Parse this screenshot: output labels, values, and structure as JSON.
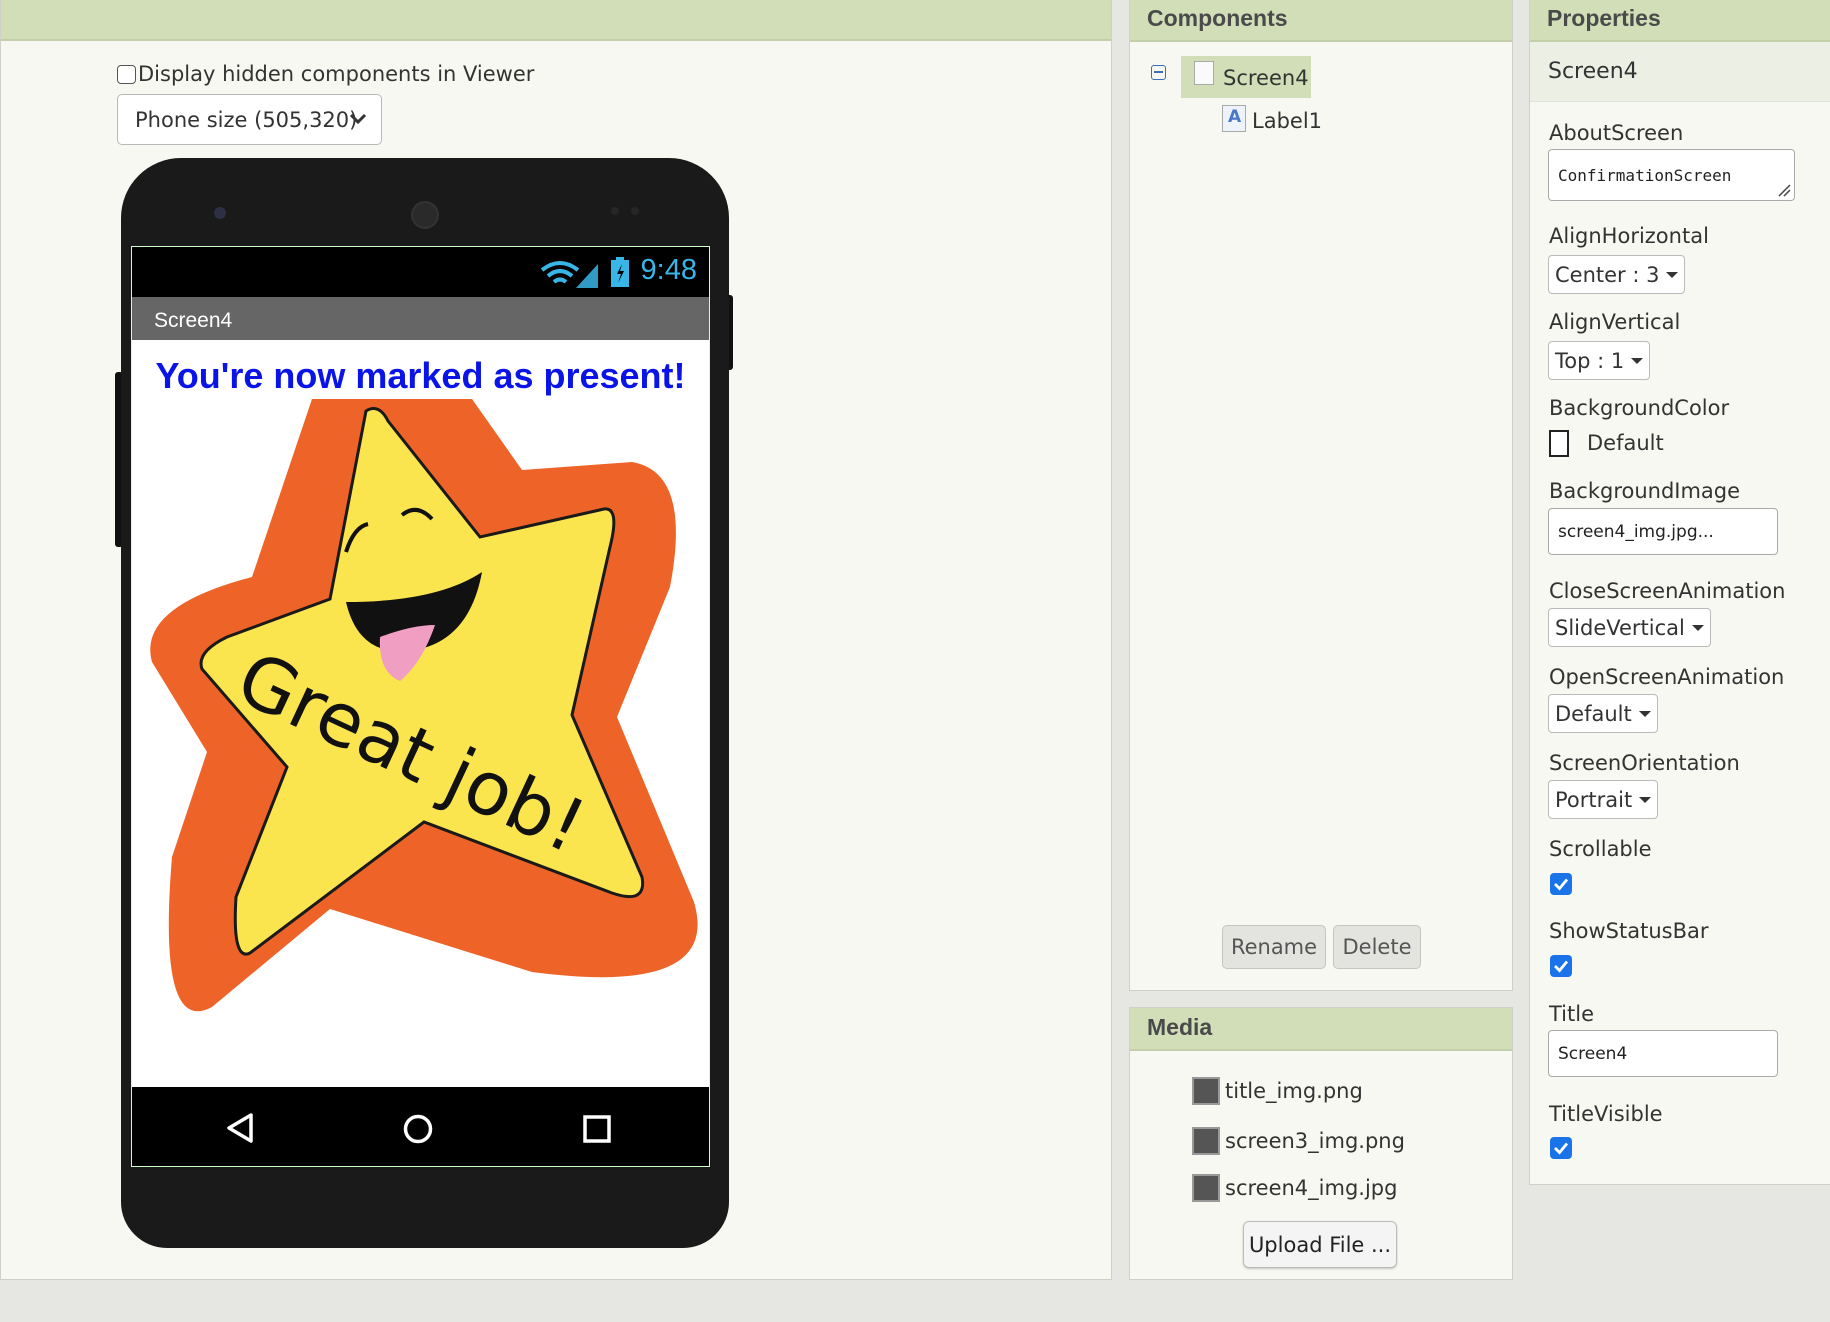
{
  "viewer": {
    "hidden_components_label": "Display hidden components in Viewer",
    "phone_size_selected": "Phone size (505,320)",
    "phone": {
      "clock": "9:48",
      "screen_title": "Screen4",
      "label_text": "You're now marked as present!",
      "image_text": "Great job!"
    }
  },
  "components": {
    "header": "Components",
    "tree": [
      {
        "label": "Screen4",
        "selected": true,
        "icon": "screen-icon"
      },
      {
        "label": "Label1",
        "selected": false,
        "icon": "label-icon"
      }
    ],
    "rename_label": "Rename",
    "delete_label": "Delete"
  },
  "media": {
    "header": "Media",
    "files": [
      "title_img.png",
      "screen3_img.png",
      "screen4_img.jpg"
    ],
    "upload_label": "Upload File ..."
  },
  "properties": {
    "header": "Properties",
    "component_name": "Screen4",
    "about_screen": {
      "label": "AboutScreen",
      "value": "ConfirmationScreen"
    },
    "align_horizontal": {
      "label": "AlignHorizontal",
      "value": "Center : 3"
    },
    "align_vertical": {
      "label": "AlignVertical",
      "value": "Top : 1"
    },
    "background_color": {
      "label": "BackgroundColor",
      "value": "Default"
    },
    "background_image": {
      "label": "BackgroundImage",
      "value": "screen4_img.jpg..."
    },
    "close_screen_animation": {
      "label": "CloseScreenAnimation",
      "value": "SlideVertical"
    },
    "open_screen_animation": {
      "label": "OpenScreenAnimation",
      "value": "Default"
    },
    "screen_orientation": {
      "label": "ScreenOrientation",
      "value": "Portrait"
    },
    "scrollable": {
      "label": "Scrollable",
      "checked": true
    },
    "show_status_bar": {
      "label": "ShowStatusBar",
      "checked": true
    },
    "title": {
      "label": "Title",
      "value": "Screen4"
    },
    "title_visible": {
      "label": "TitleVisible",
      "checked": true
    }
  },
  "colors": {
    "header_green": "#d1deb7",
    "label_blue": "#0a14e6",
    "clock_blue": "#38b6e8",
    "star_yellow": "#fbe54f",
    "star_orange": "#ee6428",
    "checkbox_blue": "#1a73e8"
  }
}
